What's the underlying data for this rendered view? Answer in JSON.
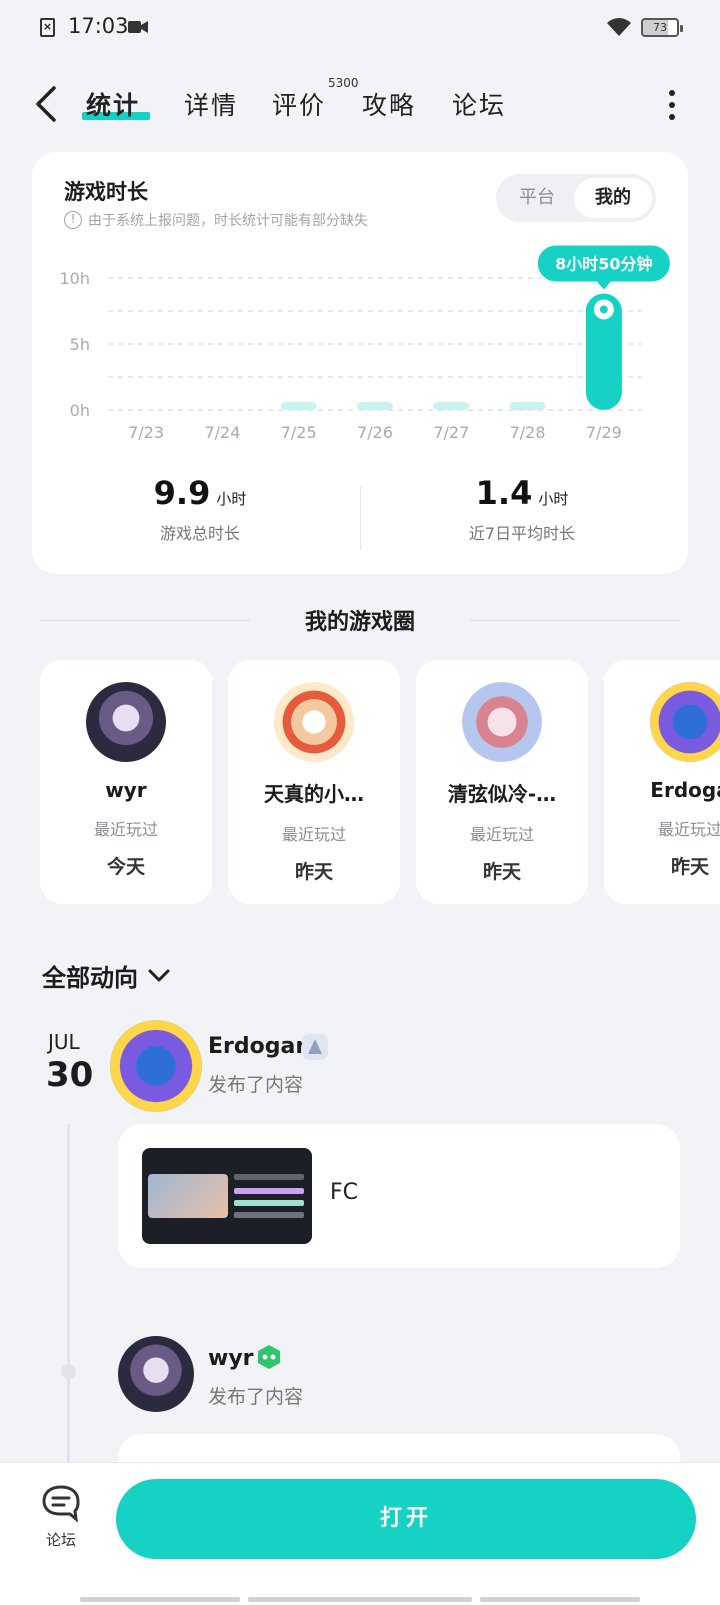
{
  "status_bar": {
    "time": "17:03",
    "battery": "73"
  },
  "nav": {
    "tabs": [
      "统计",
      "详情",
      "评价",
      "攻略",
      "论坛"
    ],
    "review_count": "5300"
  },
  "playtime": {
    "title": "游戏时长",
    "notice": "由于系统上报问题，时长统计可能有部分缺失",
    "toggle": [
      "平台",
      "我的"
    ],
    "total_value": "9.9",
    "total_unit": "小时",
    "total_label": "游戏总时长",
    "avg_value": "1.4",
    "avg_unit": "小时",
    "avg_label": "近7日平均时长"
  },
  "chart_data": {
    "type": "bar",
    "categories": [
      "7/23",
      "7/24",
      "7/25",
      "7/26",
      "7/27",
      "7/28",
      "7/29"
    ],
    "values": [
      0,
      0,
      0.15,
      0.15,
      0.15,
      0.15,
      8.83
    ],
    "yticks": [
      "0h",
      "5h",
      "10h"
    ],
    "ylim": [
      0,
      10
    ],
    "tooltip": "8小时50分钟",
    "grid": true,
    "colors": {
      "bar": "#15d2c4",
      "bar_light": "#c9f3ef"
    }
  },
  "circle": {
    "title": "我的游戏圈",
    "friends": [
      {
        "name": "wyr",
        "recent": "最近玩过",
        "when": "今天"
      },
      {
        "name": "天真的小…",
        "recent": "最近玩过",
        "when": "昨天"
      },
      {
        "name": "清弦似冷-…",
        "recent": "最近玩过",
        "when": "昨天"
      },
      {
        "name": "Erdoga",
        "recent": "最近玩过",
        "when": "昨天"
      }
    ]
  },
  "feed": {
    "filter_label": "全部动向",
    "date_month": "JUL",
    "date_day": "30",
    "posts": [
      {
        "author": "Erdogan",
        "action": "发布了内容",
        "text": "FC"
      },
      {
        "author": "wyr",
        "action": "发布了内容"
      }
    ]
  },
  "bottom": {
    "forum_label": "论坛",
    "open_label": "打开"
  }
}
